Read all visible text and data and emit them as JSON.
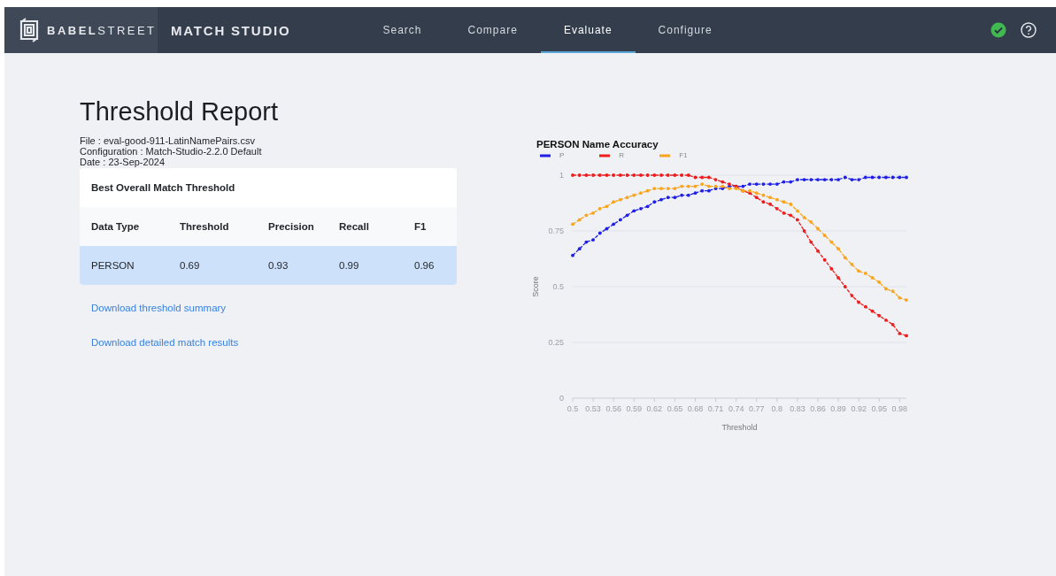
{
  "header": {
    "logo": {
      "bold": "BABEL",
      "light": "STREET"
    },
    "product": "MATCH STUDIO",
    "tabs": [
      {
        "label": "Search",
        "selected": false
      },
      {
        "label": "Compare",
        "selected": false
      },
      {
        "label": "Evaluate",
        "selected": true
      },
      {
        "label": "Configure",
        "selected": false
      }
    ],
    "status_ok": true
  },
  "report": {
    "title": "Threshold Report",
    "meta": [
      "File : eval-good-911-LatinNamePairs.csv",
      "Configuration : Match-Studio-2.2.0 Default",
      "Date : 23-Sep-2024"
    ],
    "card_title": "Best Overall Match Threshold",
    "columns": [
      "Data Type",
      "Threshold",
      "Precision",
      "Recall",
      "F1"
    ],
    "rows": [
      {
        "cells": [
          "PERSON",
          "0.69",
          "0.93",
          "0.99",
          "0.96"
        ],
        "selected": true
      }
    ],
    "links": [
      "Download threshold summary",
      "Download detailed match results"
    ]
  },
  "chart": {
    "chart_data": {
      "type": "line",
      "title": "PERSON Name Accuracy",
      "xlabel": "Threshold",
      "ylabel": "Score",
      "x": [
        0.5,
        0.51,
        0.52,
        0.53,
        0.54,
        0.55,
        0.56,
        0.57,
        0.58,
        0.59,
        0.6,
        0.61,
        0.62,
        0.63,
        0.64,
        0.65,
        0.66,
        0.67,
        0.68,
        0.69,
        0.7,
        0.71,
        0.72,
        0.73,
        0.74,
        0.75,
        0.76,
        0.77,
        0.78,
        0.79,
        0.8,
        0.81,
        0.82,
        0.83,
        0.84,
        0.85,
        0.86,
        0.87,
        0.88,
        0.89,
        0.9,
        0.91,
        0.92,
        0.93,
        0.94,
        0.95,
        0.96,
        0.97,
        0.98,
        0.99
      ],
      "series": [
        {
          "name": "P",
          "color": "#1f1fe6",
          "line_style": "dashed",
          "values": [
            0.64,
            0.67,
            0.7,
            0.71,
            0.74,
            0.76,
            0.78,
            0.8,
            0.82,
            0.84,
            0.85,
            0.86,
            0.88,
            0.89,
            0.9,
            0.9,
            0.91,
            0.91,
            0.92,
            0.93,
            0.93,
            0.94,
            0.94,
            0.95,
            0.95,
            0.95,
            0.96,
            0.96,
            0.96,
            0.96,
            0.96,
            0.97,
            0.97,
            0.98,
            0.98,
            0.98,
            0.98,
            0.98,
            0.98,
            0.98,
            0.99,
            0.98,
            0.98,
            0.99,
            0.99,
            0.99,
            0.99,
            0.99,
            0.99,
            0.99
          ]
        },
        {
          "name": "R",
          "color": "#ee1c1c",
          "line_style": "dashed",
          "values": [
            1,
            1,
            1,
            1,
            1,
            1,
            1,
            1,
            1,
            1,
            1,
            1,
            1,
            1,
            1,
            1,
            1,
            1,
            0.99,
            0.99,
            0.99,
            0.98,
            0.97,
            0.96,
            0.95,
            0.93,
            0.92,
            0.9,
            0.88,
            0.87,
            0.85,
            0.83,
            0.82,
            0.8,
            0.75,
            0.7,
            0.66,
            0.62,
            0.58,
            0.54,
            0.5,
            0.46,
            0.43,
            0.41,
            0.39,
            0.37,
            0.35,
            0.33,
            0.29,
            0.28
          ]
        },
        {
          "name": "F1",
          "color": "#f8a51c",
          "line_style": "dashed",
          "values": [
            0.78,
            0.8,
            0.82,
            0.83,
            0.85,
            0.86,
            0.88,
            0.89,
            0.9,
            0.91,
            0.92,
            0.93,
            0.94,
            0.94,
            0.94,
            0.94,
            0.95,
            0.95,
            0.95,
            0.96,
            0.95,
            0.95,
            0.95,
            0.94,
            0.94,
            0.93,
            0.93,
            0.92,
            0.91,
            0.9,
            0.89,
            0.88,
            0.87,
            0.84,
            0.81,
            0.79,
            0.76,
            0.73,
            0.7,
            0.67,
            0.63,
            0.6,
            0.57,
            0.56,
            0.54,
            0.52,
            0.49,
            0.48,
            0.45,
            0.44
          ]
        }
      ],
      "xlim": [
        0.5,
        0.99
      ],
      "ylim": [
        0,
        1
      ],
      "grid": true,
      "legend": true,
      "xticks": [
        0.5,
        0.53,
        0.56,
        0.59,
        0.62,
        0.65,
        0.68,
        0.71,
        0.74,
        0.77,
        0.8,
        0.83,
        0.86,
        0.89,
        0.92,
        0.95,
        0.98
      ],
      "yticks": [
        0,
        0.25,
        0.5,
        0.75,
        1
      ]
    }
  }
}
